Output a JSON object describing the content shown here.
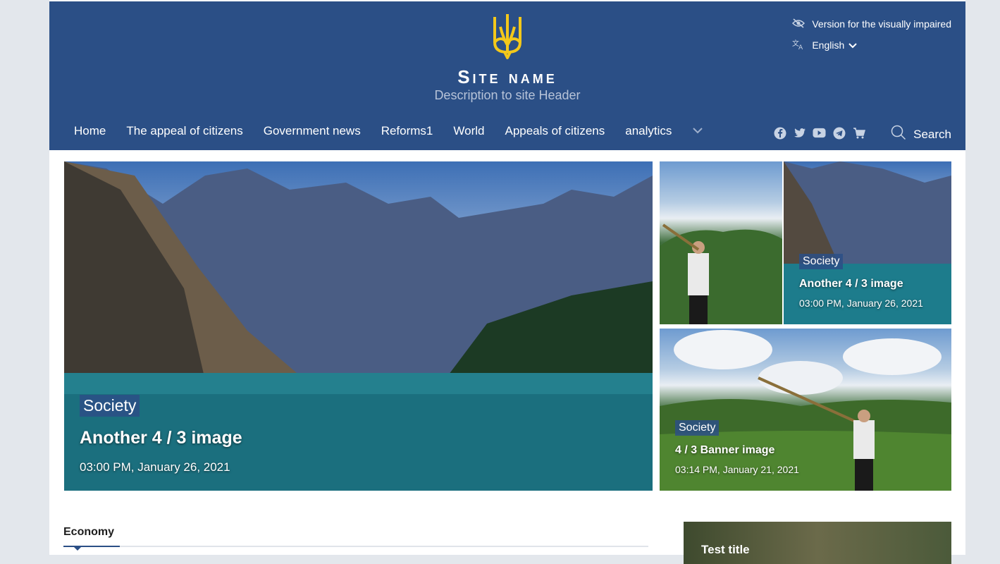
{
  "header": {
    "site_name": "Site name",
    "description": "Description to site Header",
    "visually_impaired": "Version for the visually impaired",
    "language": "English",
    "search_label": "Search",
    "emblem_color": "#f3c81a",
    "background": "#2b4f86"
  },
  "nav": {
    "items": [
      {
        "label": "Home"
      },
      {
        "label": "The appeal of citizens"
      },
      {
        "label": "Government news"
      },
      {
        "label": "Reforms1"
      },
      {
        "label": "World"
      },
      {
        "label": "Appeals of citizens"
      },
      {
        "label": "analytics"
      }
    ],
    "more_icon": "chevron-down-icon"
  },
  "social": [
    "facebook-icon",
    "twitter-icon",
    "youtube-icon",
    "telegram-icon",
    "cart-icon"
  ],
  "featured": {
    "main": {
      "category": "Society",
      "title": "Another 4 / 3 image",
      "date": "03:00 PM, January 26, 2021"
    },
    "top_right": {
      "category": "Society",
      "title": "Another 4 / 3 image",
      "date": "03:00 PM, January 26, 2021"
    },
    "bottom_right": {
      "category": "Society",
      "title": "4 / 3 Banner image",
      "date": "03:14 PM, January 21, 2021"
    }
  },
  "sections": {
    "economy_title": "Economy",
    "side_card_title": "Test title"
  }
}
